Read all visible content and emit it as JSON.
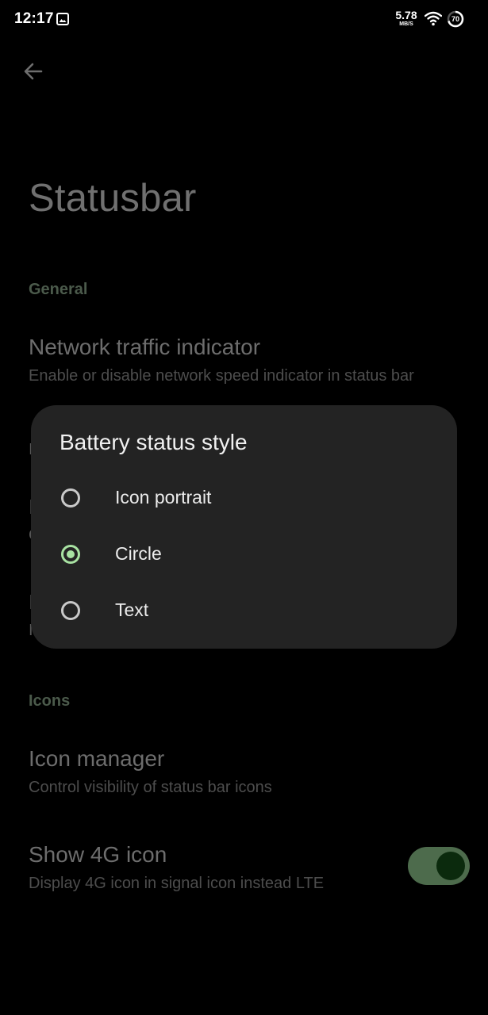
{
  "status_bar": {
    "time": "12:17",
    "gallery_icon": "image-icon",
    "network_speed_value": "5.78",
    "network_speed_unit": "MB/S",
    "wifi_icon": "wifi-icon",
    "battery_level": "70"
  },
  "page": {
    "back_icon": "arrow-left-icon",
    "title": "Statusbar",
    "general": {
      "header": "General",
      "network_traffic": {
        "title": "Network traffic indicator",
        "summary": "Enable or disable network speed indicator in status bar"
      }
    },
    "icons": {
      "header": "Icons",
      "icon_manager": {
        "title": "Icon manager",
        "summary": "Control visibility of status bar icons"
      },
      "show_4g": {
        "title": "Show 4G icon",
        "summary": "Display 4G icon in signal icon instead LTE",
        "enabled": true
      }
    },
    "peek_letters": {
      "first": "I",
      "second": "I",
      "third": "C",
      "fourth": "I",
      "fifth": "I"
    }
  },
  "dialog": {
    "title": "Battery status style",
    "options": [
      {
        "label": "Icon portrait",
        "checked": false
      },
      {
        "label": "Circle",
        "checked": true
      },
      {
        "label": "Text",
        "checked": false
      }
    ]
  },
  "colors": {
    "accent": "#a8e2a2",
    "dialog_bg": "#232323",
    "toggle_track": "#4d6b4c"
  }
}
